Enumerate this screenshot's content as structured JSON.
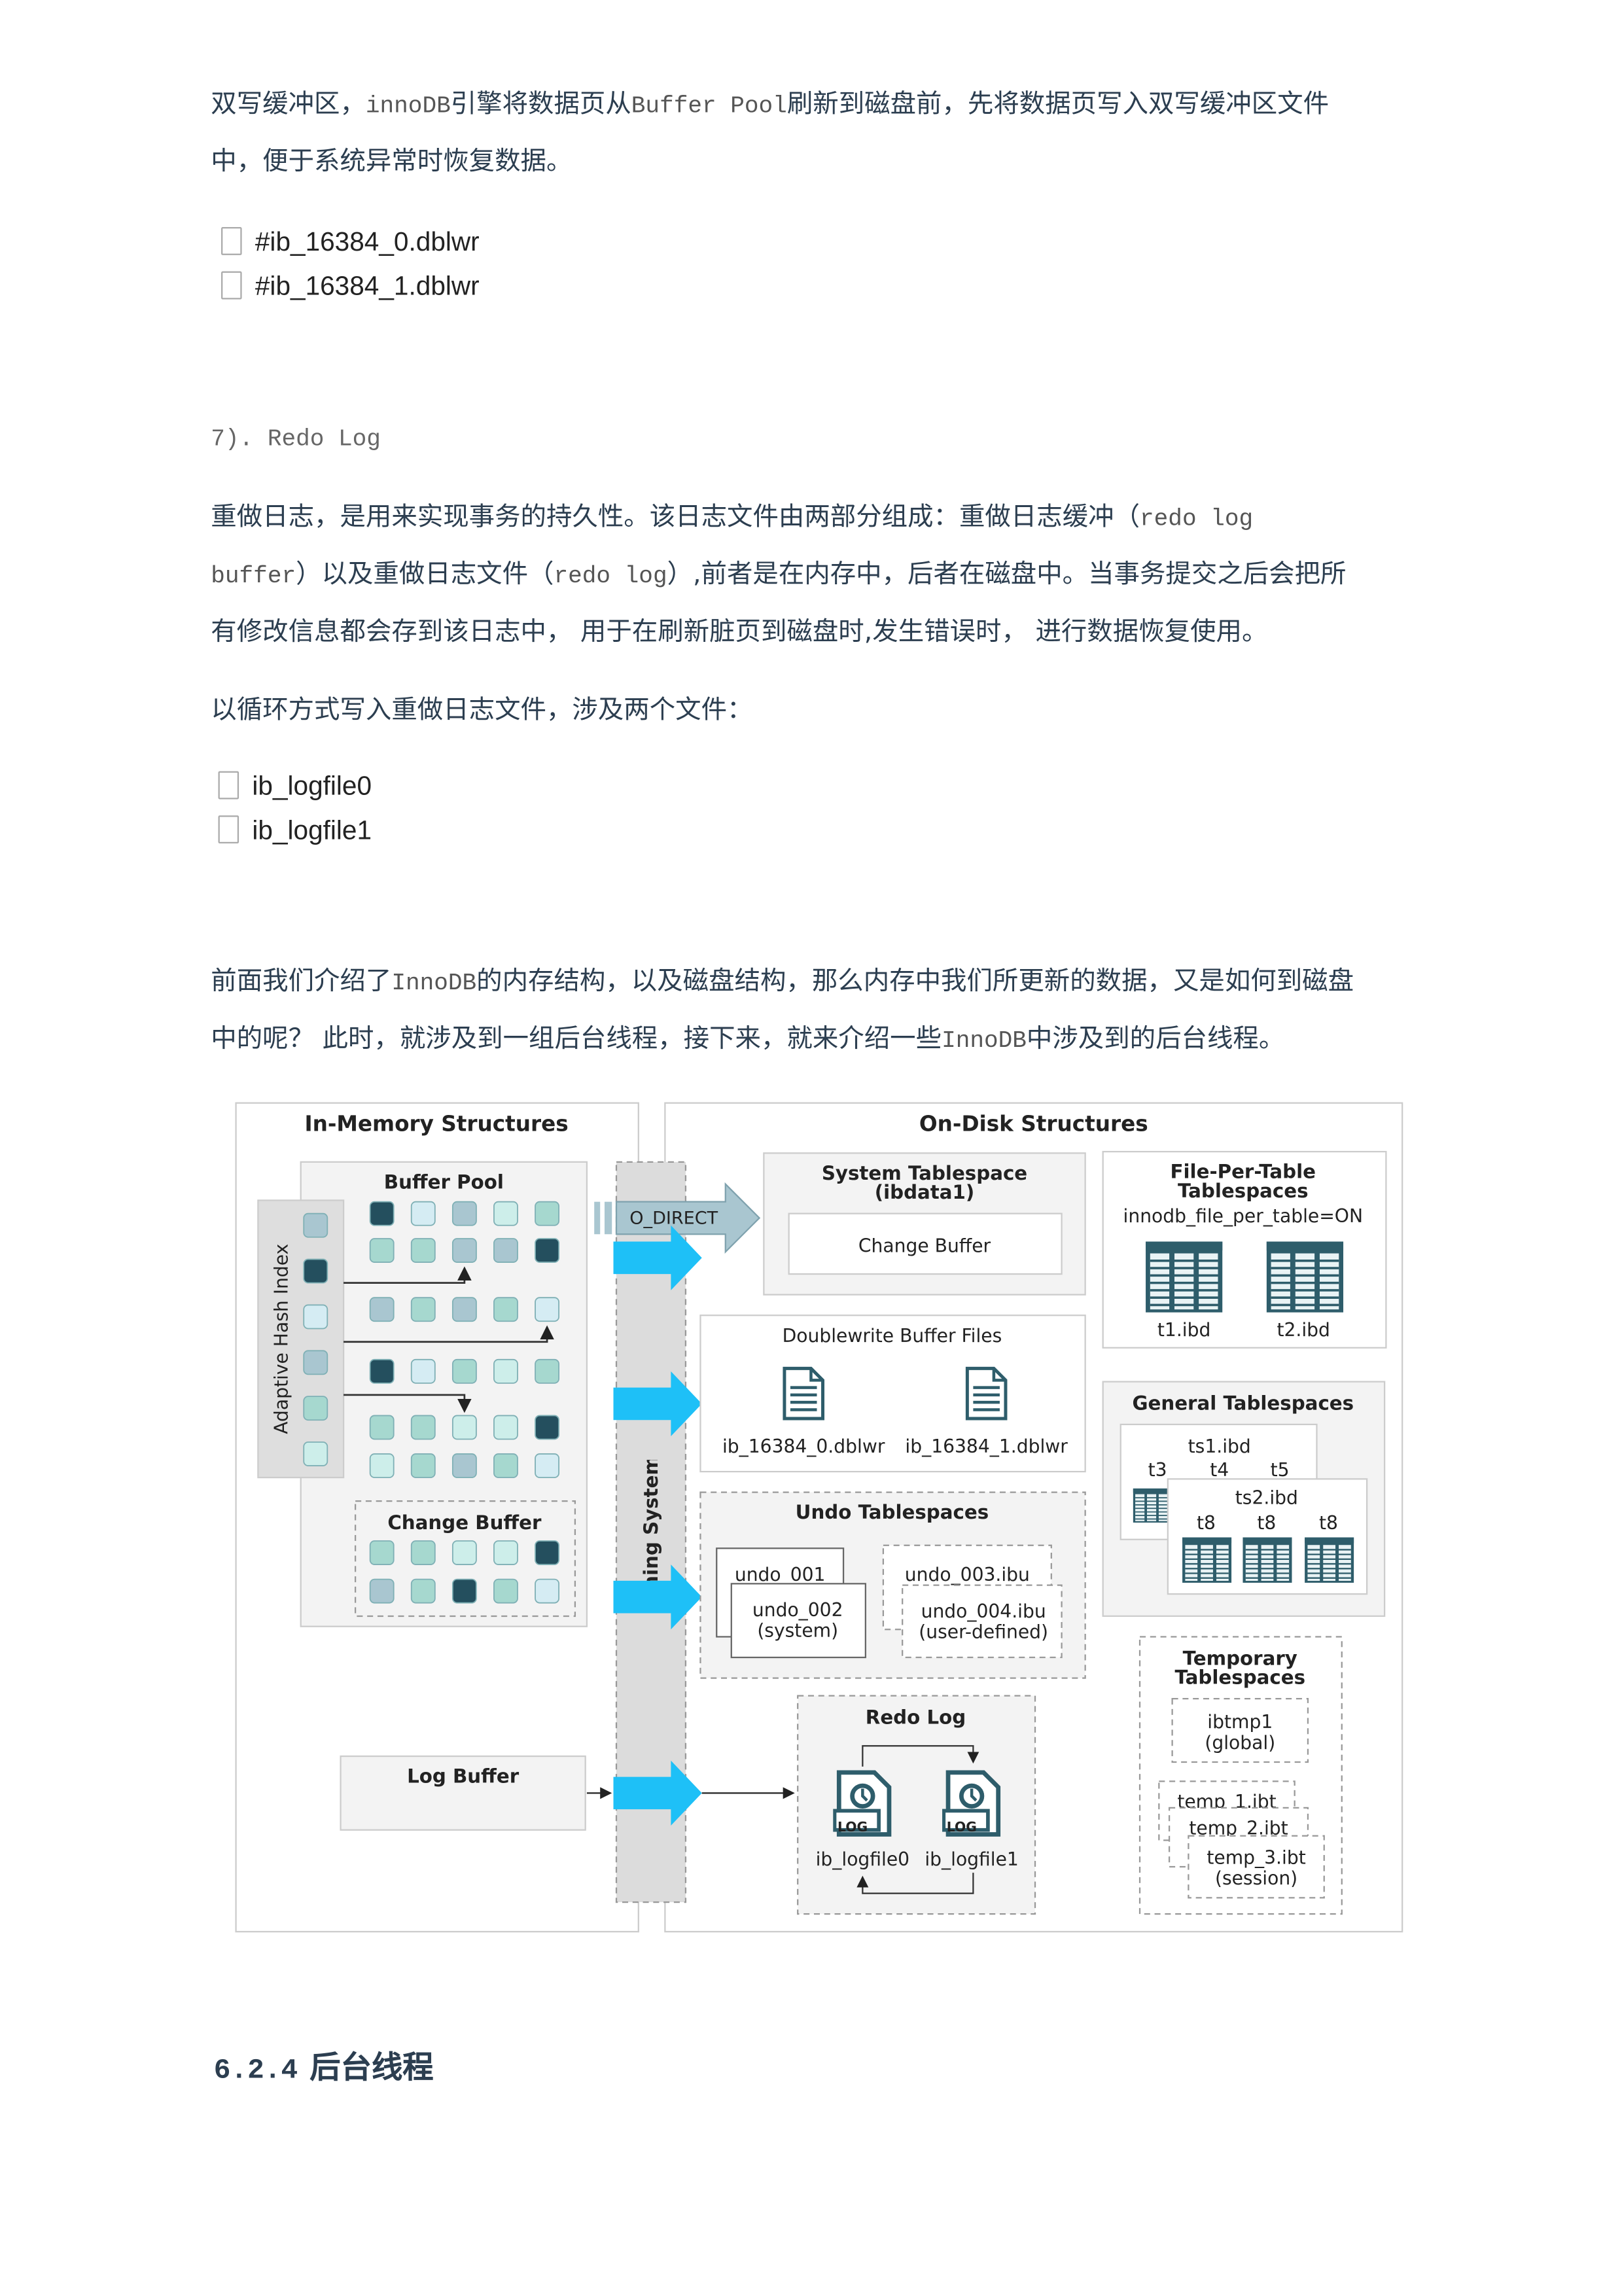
{
  "doublewrite_para": {
    "lines": [
      [
        {
          "t": "双写缓冲区，"
        },
        {
          "t": "innoDB",
          "m": 1
        },
        {
          "t": "引擎将数据页从"
        },
        {
          "t": "Buffer Pool",
          "m": 1
        },
        {
          "t": "刷新到磁盘前，先将数据页写入双写缓冲区文件"
        }
      ],
      [
        {
          "t": "中，便于系统异常时恢复数据。"
        }
      ]
    ]
  },
  "doublewrite_files": [
    "#ib_16384_0.dblwr",
    "#ib_16384_1.dblwr"
  ],
  "redo_heading": "7). Redo Log",
  "redo_para": {
    "lines": [
      [
        {
          "t": "重做日志，是用来实现事务的持久性。该日志文件由两部分组成：重做日志缓冲（"
        },
        {
          "t": "redo log",
          "m": 1
        }
      ],
      [
        {
          "t": "buffer",
          "m": 1
        },
        {
          "t": "）以及重做日志文件（"
        },
        {
          "t": "redo log",
          "m": 1
        },
        {
          "t": "）,前者是在内存中，后者在磁盘中。当事务提交之后会把所"
        }
      ],
      [
        {
          "t": "有修改信息都会存到该日志中， 用于在刷新脏页到磁盘时,发生错误时， 进行数据恢复使用。"
        }
      ]
    ]
  },
  "redo_files_intro": "以循环方式写入重做日志文件，涉及两个文件：",
  "redo_files": [
    "ib_logfile0",
    "ib_logfile1"
  ],
  "bg_para": {
    "lines": [
      [
        {
          "t": "前面我们介绍了"
        },
        {
          "t": "InnoDB",
          "m": 1
        },
        {
          "t": "的内存结构，以及磁盘结构，那么内存中我们所更新的数据，又是如何到磁盘"
        }
      ],
      [
        {
          "t": "中的呢？  此时，就涉及到一组后台线程，接下来，就来介绍一些"
        },
        {
          "t": "InnoDB",
          "m": 1
        },
        {
          "t": "中涉及到的后台线程。"
        }
      ]
    ]
  },
  "diagram": {
    "in_memory_title": "In-Memory Structures",
    "on_disk_title": "On-Disk Structures",
    "buffer_pool": "Buffer Pool",
    "adaptive_hash_index": "Adaptive Hash Index",
    "change_buffer_mem": "Change Buffer",
    "log_buffer": "Log Buffer",
    "os_cache": "Operationing System Cache",
    "o_direct": "O_DIRECT",
    "system_tablespace": [
      "System Tablespace",
      "(ibdata1)"
    ],
    "change_buffer_disk": "Change Buffer",
    "file_per_table": [
      "File-Per-Table",
      "Tablespaces"
    ],
    "file_per_table_setting": "innodb_file_per_table=ON",
    "file_per_table_files": [
      "t1.ibd",
      "t2.ibd"
    ],
    "doublewrite_title": "Doublewrite Buffer Files",
    "doublewrite_files": [
      "ib_16384_0.dblwr",
      "ib_16384_1.dblwr"
    ],
    "undo_title": "Undo Tablespaces",
    "undo": [
      "undo_001",
      "undo_002",
      "(system)",
      "undo_003.ibu",
      "undo_004.ibu",
      "(user-defined)"
    ],
    "general_title": "General Tablespaces",
    "ts1": "ts1.ibd",
    "ts1_tables": [
      "t3",
      "t4",
      "t5"
    ],
    "ts2": "ts2.ibd",
    "ts2_tables": [
      "t8",
      "t8",
      "t8"
    ],
    "temp_title": [
      "Temporary",
      "Tablespaces"
    ],
    "ibtmp": [
      "ibtmp1",
      "(global)"
    ],
    "temp_files": [
      "temp_1.ibt",
      "temp_2.ibt",
      "temp_3.ibt",
      "(session)"
    ],
    "redo_title": "Redo Log",
    "redo_files": [
      "ib_logfile0",
      "ib_logfile1"
    ],
    "log_icon_label": "LOG",
    "colors": {
      "dark": "#244f5e",
      "light": "#d5ecf3",
      "gray": "#a9c6d0",
      "teal": "#a6d8cf",
      "pale": "#cdeeea",
      "cyan_arrow": "#1ec0f7",
      "o_direct_arrow": "#a9c6d0"
    },
    "buffer_pool_pages": [
      [
        "dark",
        "light",
        "gray",
        "pale",
        "teal"
      ],
      [
        "teal",
        "teal",
        "gray",
        "gray",
        "dark"
      ],
      [
        "gray",
        "teal",
        "gray",
        "teal",
        "light"
      ],
      [
        "dark",
        "light",
        "teal",
        "pale",
        "teal"
      ],
      [
        "teal",
        "teal",
        "pale",
        "pale",
        "dark"
      ],
      [
        "pale",
        "teal",
        "gray",
        "teal",
        "light"
      ]
    ],
    "hash_index_entries": [
      "gray",
      "dark",
      "light",
      "gray",
      "teal",
      "pale"
    ],
    "change_buffer_pages": [
      [
        "teal",
        "teal",
        "pale",
        "pale",
        "dark"
      ],
      [
        "gray",
        "teal",
        "dark",
        "teal",
        "light"
      ]
    ],
    "log_buffer_pages": [
      "light",
      "teal",
      "pale",
      "dark",
      "teal"
    ]
  },
  "section_heading": {
    "number": "6.2.4",
    "title": "后台线程"
  }
}
